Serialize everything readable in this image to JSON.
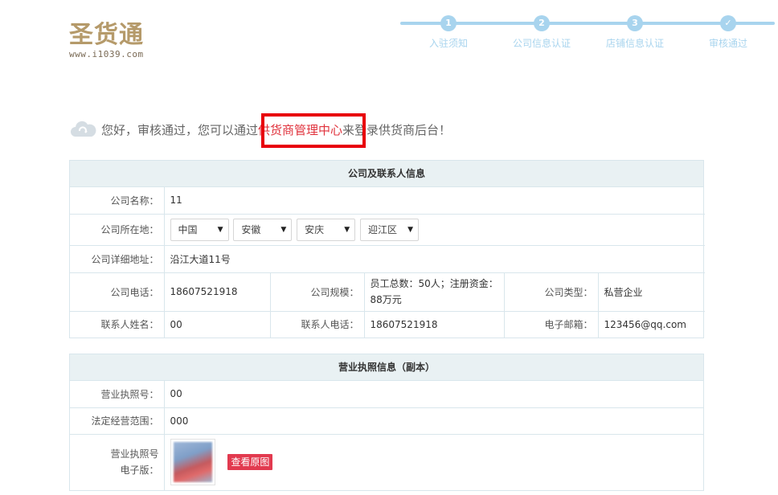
{
  "logo": {
    "name": "圣货通",
    "url": "www.i1039.com"
  },
  "steps": [
    {
      "num": "1",
      "label": "入驻须知"
    },
    {
      "num": "2",
      "label": "公司信息认证"
    },
    {
      "num": "3",
      "label": "店铺信息认证"
    },
    {
      "num": "✓",
      "label": "审核通过"
    }
  ],
  "message": {
    "prefix": "您好，审核通过，您可以通过",
    "link": "供货商管理中心",
    "suffix": "来登录供货商后台！",
    "icon": "cloud-icon"
  },
  "company_panel": {
    "title": "公司及联系人信息",
    "name_label": "公司名称：",
    "name_value": "11",
    "location_label": "公司所在地：",
    "location": {
      "country": "中国",
      "province": "安徽",
      "city": "安庆",
      "district": "迎江区"
    },
    "address_label": "公司详细地址：",
    "address_value": "沿江大道11号",
    "phone_label": "公司电话：",
    "phone_value": "18607521918",
    "scale_label": "公司规模：",
    "scale_value": "员工总数：50人；注册资金：88万元",
    "type_label": "公司类型：",
    "type_value": "私营企业",
    "contact_name_label": "联系人姓名：",
    "contact_name_value": "00",
    "contact_phone_label": "联系人电话：",
    "contact_phone_value": "18607521918",
    "email_label": "电子邮箱：",
    "email_value": "123456@qq.com"
  },
  "license_panel": {
    "title": "营业执照信息（副本）",
    "number_label": "营业执照号：",
    "number_value": "00",
    "scope_label": "法定经营范围：",
    "scope_value": "000",
    "ebook_label_line1": "营业执照号",
    "ebook_label_line2": "电子版：",
    "view_button": "查看原图"
  },
  "colors": {
    "accent": "#a8d4ee",
    "link_red": "#e0323c",
    "highlight": "#e8000b",
    "button": "#e23a4f"
  }
}
